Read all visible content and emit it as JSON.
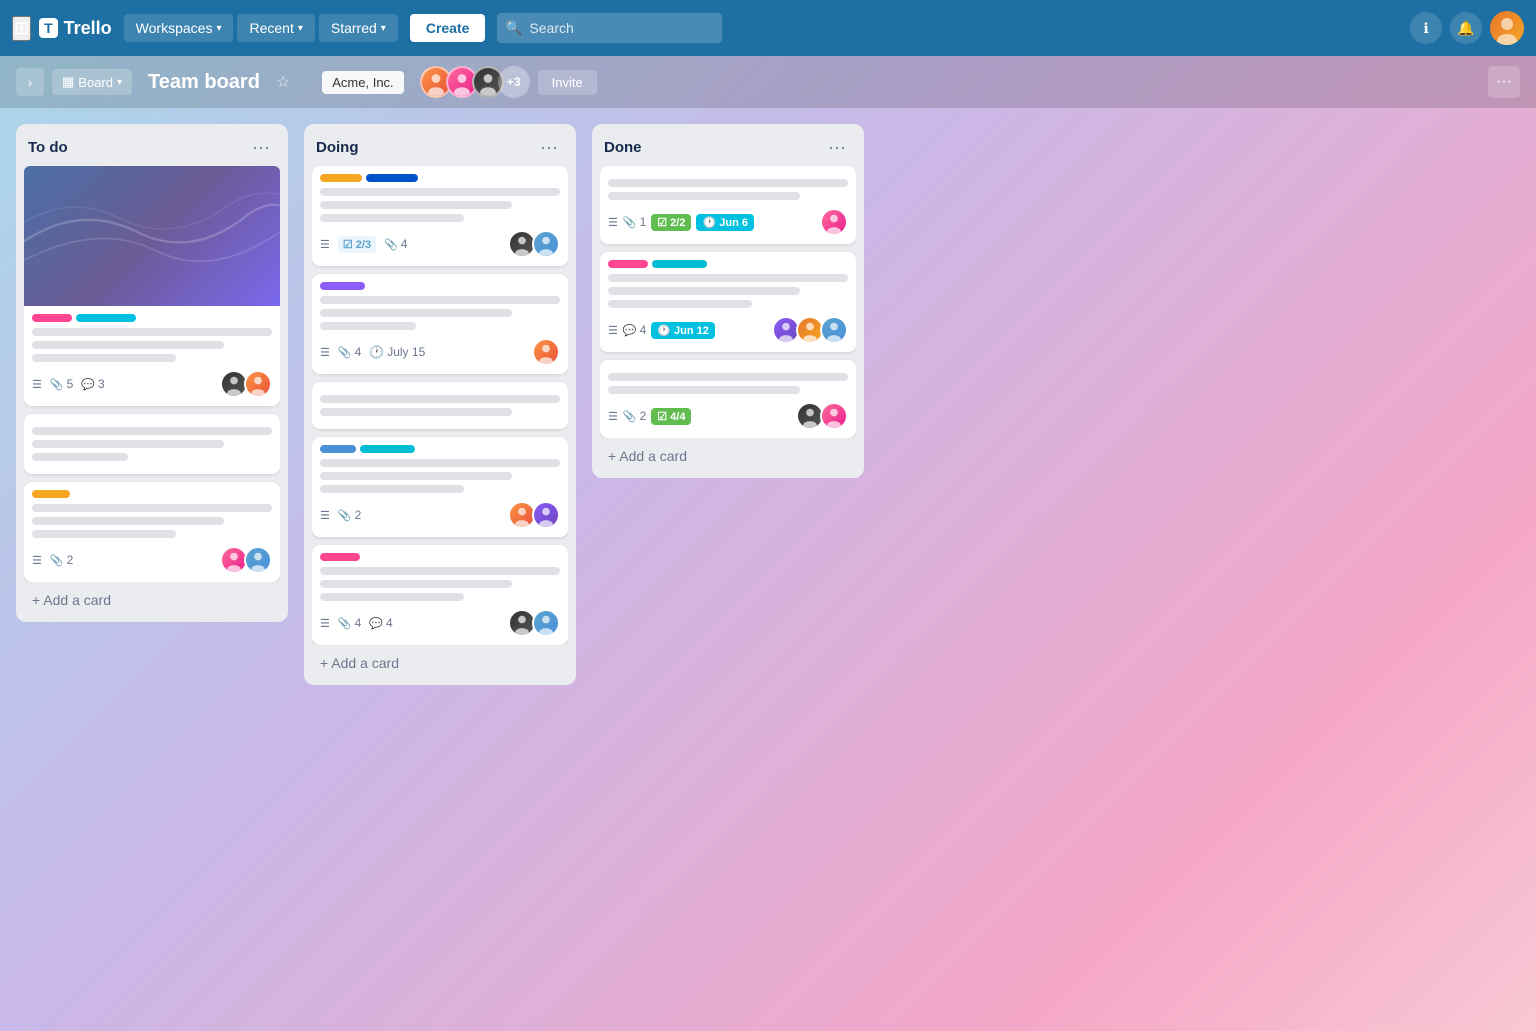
{
  "navbar": {
    "logo": "Trello",
    "logo_mark": "T",
    "workspaces_label": "Workspaces",
    "recent_label": "Recent",
    "starred_label": "Starred",
    "create_label": "Create",
    "search_placeholder": "Search",
    "chevron": "▾"
  },
  "board_header": {
    "board_view_label": "Board",
    "board_title": "Team board",
    "workspace_name": "Acme, Inc.",
    "plus_members": "+3",
    "invite_label": "Invite"
  },
  "columns": [
    {
      "id": "todo",
      "title": "To do",
      "cards": [
        {
          "id": "c1",
          "has_cover": true,
          "tags": [
            "pink",
            "cyan"
          ],
          "lines": [
            "long",
            "medium",
            "short"
          ],
          "meta": {
            "desc": true,
            "attachments": 5,
            "comments": 3
          },
          "avatars": [
            "face-c",
            "face-g"
          ]
        },
        {
          "id": "c2",
          "has_cover": false,
          "tags": [],
          "lines": [
            "long",
            "medium",
            "xshort"
          ],
          "meta": {
            "desc": false,
            "attachments": 0,
            "comments": 0
          },
          "avatars": []
        },
        {
          "id": "c3",
          "has_cover": false,
          "tags": [
            "yellow"
          ],
          "lines": [
            "long",
            "medium",
            "short"
          ],
          "meta": {
            "desc": true,
            "attachments": 2,
            "comments": 0
          },
          "avatars": [
            "face-e",
            "face-b"
          ]
        }
      ],
      "add_card_label": "+ Add a card"
    },
    {
      "id": "doing",
      "title": "Doing",
      "cards": [
        {
          "id": "c4",
          "has_cover": false,
          "tags": [
            "yellow2",
            "blue"
          ],
          "lines": [
            "long",
            "medium",
            "short"
          ],
          "meta": {
            "desc": true,
            "checklist": "2/3",
            "attachments": 4
          },
          "avatars": [
            "face-c",
            "face-b"
          ]
        },
        {
          "id": "c5",
          "has_cover": false,
          "tags": [
            "purple"
          ],
          "lines": [
            "long",
            "medium",
            "xshort"
          ],
          "meta": {
            "desc": true,
            "attachments": 4,
            "due": "July 15"
          },
          "avatars": [
            "face-g"
          ]
        },
        {
          "id": "c6",
          "has_cover": false,
          "tags": [],
          "lines": [
            "long",
            "medium"
          ],
          "meta": {
            "desc": false,
            "attachments": 0,
            "comments": 0
          },
          "avatars": []
        },
        {
          "id": "c7",
          "has_cover": false,
          "tags": [
            "blue2",
            "cyan2"
          ],
          "lines": [
            "long",
            "medium",
            "short"
          ],
          "meta": {
            "desc": true,
            "attachments": 2
          },
          "avatars": [
            "face-g",
            "face-d"
          ]
        },
        {
          "id": "c8",
          "has_cover": false,
          "tags": [
            "pink2"
          ],
          "lines": [
            "long",
            "medium",
            "short"
          ],
          "meta": {
            "desc": true,
            "attachments": 4,
            "comments": 4
          },
          "avatars": [
            "face-c",
            "face-b"
          ]
        }
      ],
      "add_card_label": "+ Add a card"
    },
    {
      "id": "done",
      "title": "Done",
      "cards": [
        {
          "id": "c9",
          "has_cover": false,
          "tags": [],
          "lines": [
            "long",
            "medium"
          ],
          "meta": {
            "desc": true,
            "attachments": 1,
            "checklist_badge": "2/2",
            "due_badge": "Jun 6"
          },
          "avatars": [
            "face-e"
          ]
        },
        {
          "id": "c10",
          "has_cover": false,
          "tags": [
            "pink3",
            "teal"
          ],
          "lines": [
            "long",
            "medium",
            "short"
          ],
          "meta": {
            "desc": true,
            "comments": 4,
            "due_badge": "Jun 12"
          },
          "avatars": [
            "face-d",
            "face-a",
            "face-b"
          ]
        },
        {
          "id": "c11",
          "has_cover": false,
          "tags": [],
          "lines": [
            "long",
            "medium"
          ],
          "meta": {
            "desc": true,
            "attachments": 2,
            "checklist_badge": "4/4"
          },
          "avatars": [
            "face-c",
            "face-e"
          ]
        }
      ],
      "add_card_label": "+ Add a card"
    }
  ]
}
